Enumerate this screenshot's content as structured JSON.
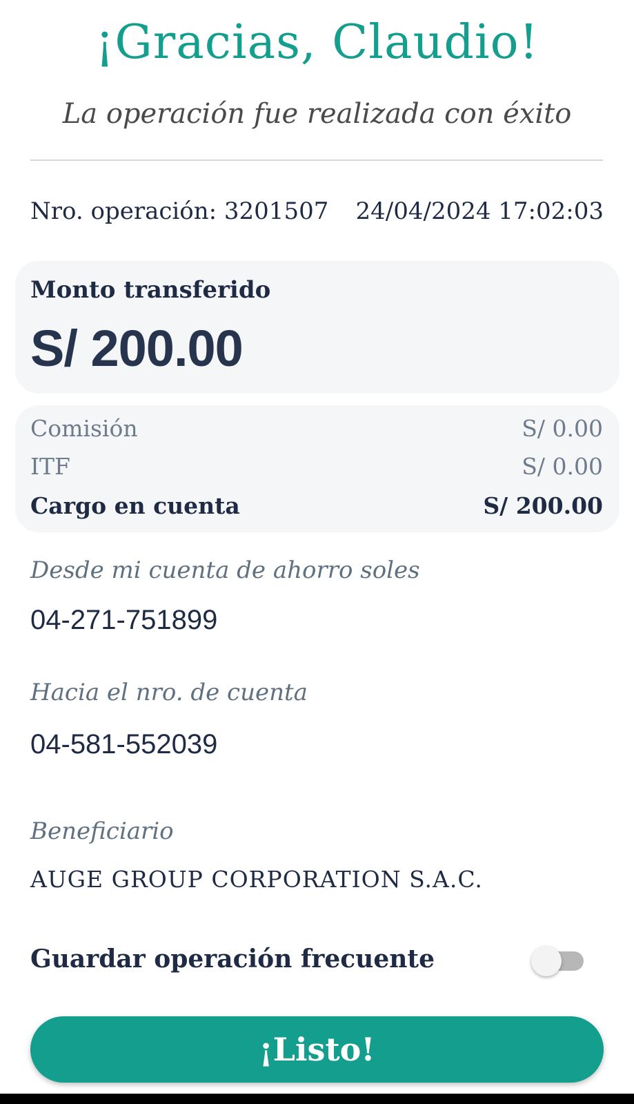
{
  "header": {
    "title": "¡Gracias, Claudio!",
    "subtitle": "La operación fue realizada con éxito"
  },
  "operation": {
    "number_text": "Nro. operación: 3201507",
    "datetime": "24/04/2024 17:02:03"
  },
  "amount": {
    "label": "Monto transferido",
    "value": "S/ 200.00"
  },
  "fees": [
    {
      "label": "Comisión",
      "value": "S/ 0.00"
    },
    {
      "label": "ITF",
      "value": "S/ 0.00"
    },
    {
      "label": "Cargo en cuenta",
      "value": "S/ 200.00"
    }
  ],
  "from": {
    "label": "Desde mi cuenta de ahorro soles",
    "account": "04-271-751899"
  },
  "to": {
    "label": "Hacia el nro. de cuenta",
    "account": "04-581-552039"
  },
  "beneficiary": {
    "label": "Beneficiario",
    "name": "AUGE GROUP CORPORATION S.A.C."
  },
  "save_frequent": {
    "label": "Guardar operación frecuente",
    "enabled": false
  },
  "actions": {
    "done_label": "¡Listo!"
  },
  "colors": {
    "accent": "#149e8e",
    "text_dark": "#1f2a44",
    "text_muted": "#6d7b8c",
    "card_bg": "#f5f6f7"
  }
}
